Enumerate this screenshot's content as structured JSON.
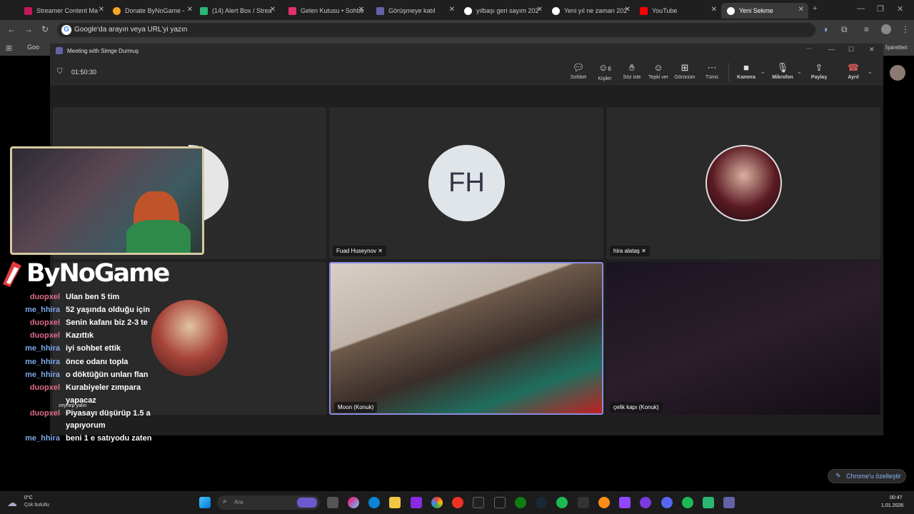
{
  "browser": {
    "tabs": [
      {
        "label": "Streamer Content Ma",
        "color": "#c2185b"
      },
      {
        "label": "Donate ByNoGame -",
        "color": "#f5a623"
      },
      {
        "label": "(14) Alert Box / Strea",
        "color": "#2bb673"
      },
      {
        "label": "Gelen Kutusu • Sohbe",
        "color": "#e1306c"
      },
      {
        "label": "Görüşmeye katıl",
        "color": "#6264a7"
      },
      {
        "label": "yılbaşı geri sayım 202",
        "color": "#ffffff"
      },
      {
        "label": "Yeni yıl ne zaman 202",
        "color": "#ffffff"
      },
      {
        "label": "YouTube",
        "color": "#ff0000"
      },
      {
        "label": "Yeni Sekme",
        "color": "#ffffff"
      }
    ],
    "address_placeholder": "Google'da arayın veya URL'yi yazın",
    "bookmark_first": "Goo",
    "bookmark_right": "İşaretleri"
  },
  "teams": {
    "window_title": "Meeting with Simge Durmuş",
    "timer": "01:50:30",
    "toolbar": {
      "chat": "Sohbet",
      "people": "Kişiler",
      "people_count": "6",
      "raise": "Söz iste",
      "react": "Tepki ver",
      "view": "Görünüm",
      "more": "Tümü",
      "camera": "Kamera",
      "mic": "Mikrofon",
      "share": "Paylaş",
      "leave": "Ayrıl"
    },
    "participants": {
      "fh_initials": "FH",
      "fuad": "Fuad Huseynov",
      "hira": "hira alataş",
      "zeynep": "zeynep yalın",
      "moon": "Moon (Konuk)",
      "celik": "çelik kapı (Konuk)"
    }
  },
  "overlay": {
    "brand": "ByNoGame",
    "chat": [
      {
        "user": "duopxel",
        "msg": "Ulan ben 5 tim",
        "color": "#e06c8a"
      },
      {
        "user": "me_hhira",
        "msg": "52 yaşında olduğu için",
        "color": "#7aa7e8"
      },
      {
        "user": "duopxel",
        "msg": "Senin kafanı biz 2-3 te",
        "color": "#e06c8a"
      },
      {
        "user": "duopxel",
        "msg": "Kazıttık",
        "color": "#e06c8a"
      },
      {
        "user": "me_hhira",
        "msg": "iyi sohbet ettik",
        "color": "#7aa7e8"
      },
      {
        "user": "me_hhira",
        "msg": "önce odanı topla",
        "color": "#7aa7e8"
      },
      {
        "user": "me_hhira",
        "msg": "o döktüğün unları flan",
        "color": "#7aa7e8"
      },
      {
        "user": "duopxel",
        "msg": "Kurabiyeler zımpara",
        "color": "#e06c8a"
      },
      {
        "user": "",
        "msg": "yapacaz",
        "color": "#e06c8a"
      },
      {
        "user": "duopxel",
        "msg": "Piyasayı düşürüp 1.5 a",
        "color": "#e06c8a"
      },
      {
        "user": "",
        "msg": "yapıyorum",
        "color": "#e06c8a"
      },
      {
        "user": "me_hhira",
        "msg": "beni 1 e satıyodu zaten",
        "color": "#7aa7e8"
      }
    ]
  },
  "chrome_customize": "Chrome'u özelleştir",
  "taskbar": {
    "weather_temp": "0°C",
    "weather_desc": "Çok bulutlu",
    "search_placeholder": "Ara",
    "time": "00:47",
    "date": "1.01.2026"
  }
}
